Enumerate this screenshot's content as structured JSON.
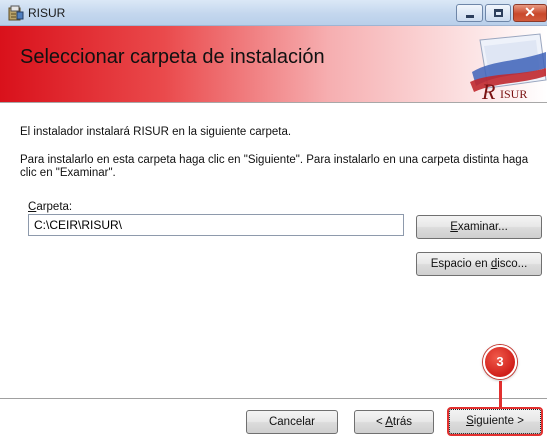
{
  "window": {
    "title": "RISUR"
  },
  "banner": {
    "title": "Seleccionar carpeta de instalación",
    "logo_text": "RISUR"
  },
  "body": {
    "line1": "El instalador instalará RISUR en la siguiente carpeta.",
    "line2": "Para instalarlo en esta carpeta haga clic en \"Siguiente\". Para instalarlo en una carpeta distinta haga clic en \"Examinar\"."
  },
  "folder": {
    "label_mnemonic": "C",
    "label_rest": "arpeta:",
    "value": "C:\\CEIR\\RISUR\\"
  },
  "buttons": {
    "examinar_mnemonic": "E",
    "examinar_rest": "xaminar...",
    "espacio_pre": "Espacio en ",
    "espacio_mnemonic": "d",
    "espacio_rest": "isco...",
    "cancelar": "Cancelar",
    "atras_pre": "< ",
    "atras_mnemonic": "A",
    "atras_rest": "trás",
    "siguiente_mnemonic": "S",
    "siguiente_rest": "iguiente >"
  },
  "annotation": {
    "step": "3"
  },
  "colors": {
    "banner_red": "#d9111b",
    "highlight": "#e2302f",
    "titlebar": "#c4d7ee"
  },
  "icons": [
    "app-installer-icon",
    "minimize-icon",
    "maximize-icon",
    "close-icon",
    "risur-logo"
  ]
}
